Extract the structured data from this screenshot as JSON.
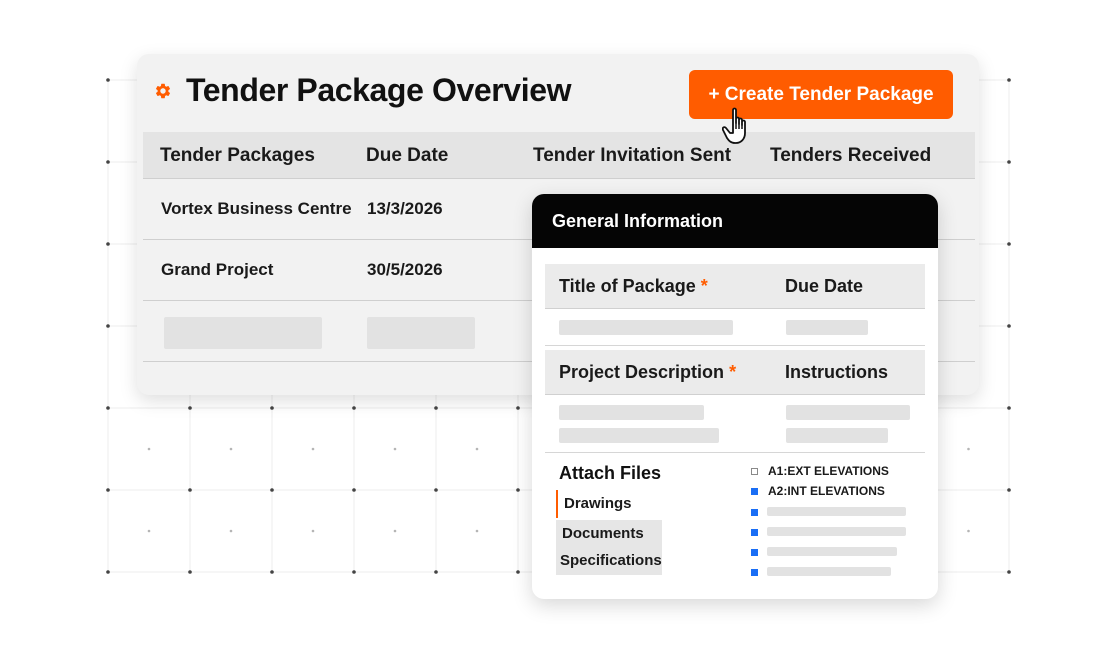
{
  "overview": {
    "title": "Tender Package Overview",
    "create_button": "+ Create Tender Package",
    "columns": [
      "Tender Packages",
      "Due Date",
      "Tender Invitation Sent",
      "Tenders Received"
    ],
    "rows": [
      {
        "package": "Vortex Business Centre",
        "due_date": "13/3/2026"
      },
      {
        "package": "Grand Project",
        "due_date": "30/5/2026"
      }
    ]
  },
  "general_info": {
    "title": "General Information",
    "field_labels": {
      "title_of_package": "Title of Package",
      "due_date": "Due Date",
      "project_description": "Project Description",
      "instructions": "Instructions"
    },
    "required_marker": "*",
    "attach_files": {
      "title": "Attach Files",
      "tabs": [
        "Drawings",
        "Documents",
        "Specifications"
      ],
      "active_tab": "Drawings",
      "files": [
        {
          "name": "A1:EXT ELEVATIONS",
          "selected": false
        },
        {
          "name": "A2:INT ELEVATIONS",
          "selected": true
        }
      ]
    }
  },
  "colors": {
    "accent": "#ff5c00",
    "selected_checkbox": "#1a6ef5",
    "panel_header": "#050505",
    "card_background": "#f2f2f2"
  },
  "icons": [
    "gear-icon",
    "pointer-hand-icon"
  ]
}
